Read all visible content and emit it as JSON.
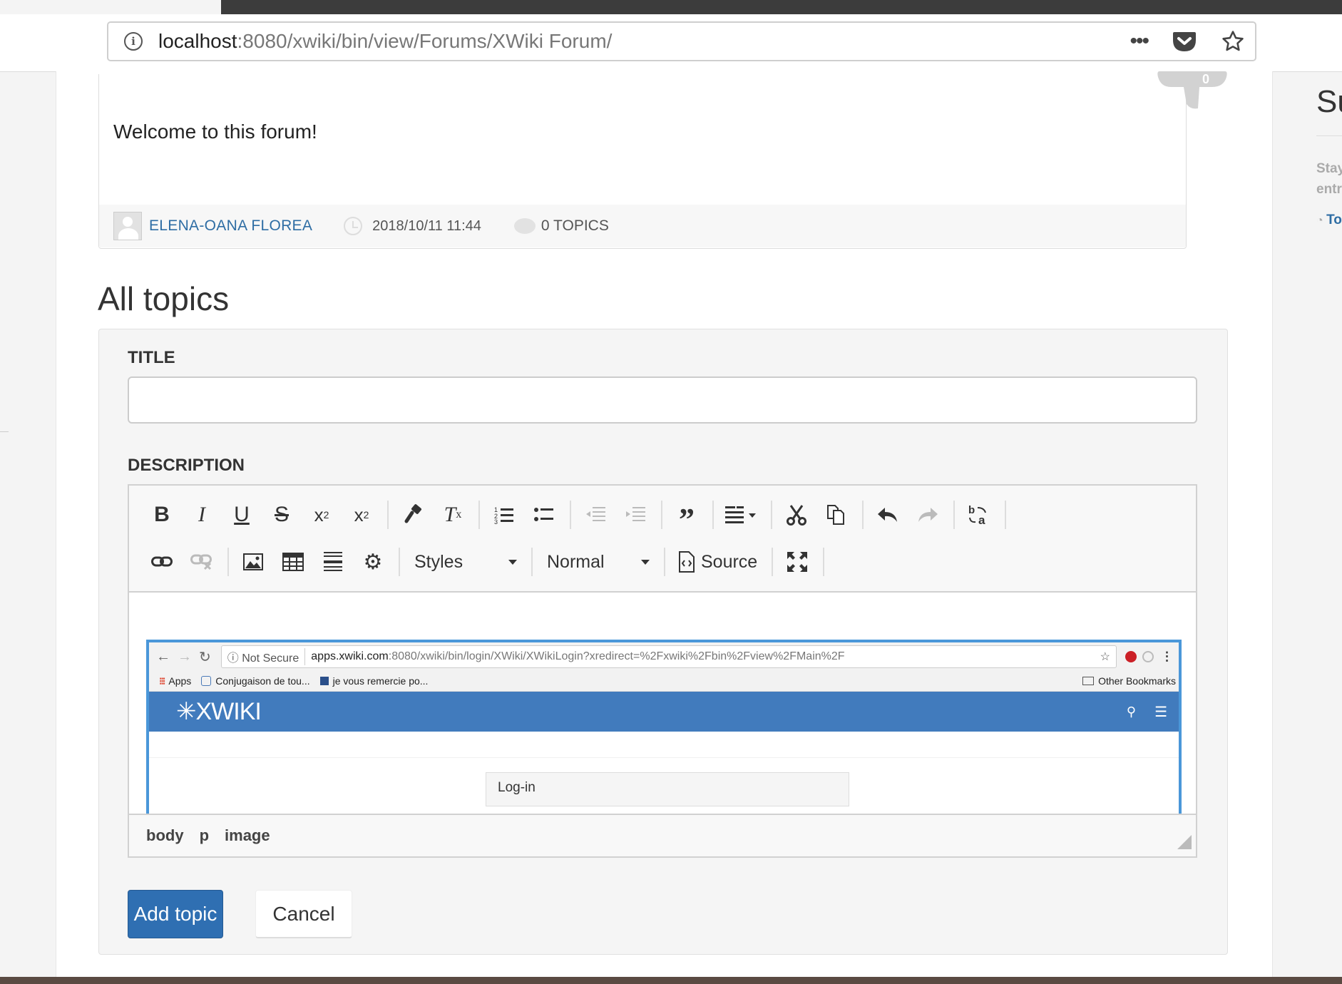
{
  "browser": {
    "url_host": "localhost",
    "url_path": ":8080/xwiki/bin/view/Forums/XWiki Forum/",
    "info_icon": "info-icon",
    "more_icon": "more-dots-icon",
    "pocket_icon": "pocket-icon",
    "bookmark_icon": "star-icon"
  },
  "sidebar": {
    "title": "Su",
    "text_line1": "Stay",
    "text_line2": "entr",
    "link": "To"
  },
  "forum": {
    "description": "Welcome to this forum!",
    "author": "ELENA-OANA FLOREA",
    "date": "2018/10/11 11:44",
    "topics_count": "0 TOPICS",
    "badge_count": "0"
  },
  "section": {
    "title": "All topics"
  },
  "form": {
    "title_label": "TITLE",
    "title_value": "",
    "description_label": "DESCRIPTION",
    "toolbar": {
      "styles_label": "Styles",
      "format_label": "Normal",
      "source_label": "Source"
    },
    "embedded": {
      "not_secure": "Not Secure",
      "url_host": "apps.xwiki.com",
      "url_path": ":8080/xwiki/bin/login/XWiki/XWikiLogin?xredirect=%2Fxwiki%2Fbin%2Fview%2FMain%2F",
      "bm_apps": "Apps",
      "bm_1": "Conjugaison de tou...",
      "bm_2": "je vous remercie po...",
      "bm_other": "Other Bookmarks",
      "logo": "XWIKI",
      "login_title": "Log-in"
    },
    "elements_path": [
      "body",
      "p",
      "image"
    ],
    "submit_label": "Add topic",
    "cancel_label": "Cancel"
  },
  "colors": {
    "primary": "#2f6fb2",
    "link": "#2e6da4",
    "xwiki_header": "#417bbd",
    "selection": "#4a97d9"
  }
}
